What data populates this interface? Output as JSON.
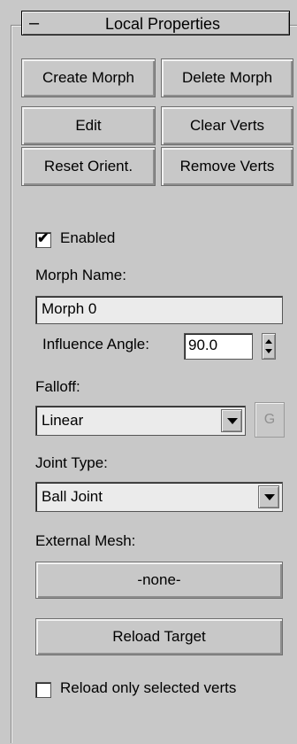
{
  "rollout": {
    "collapse_symbol": "–",
    "title": "Local Properties"
  },
  "buttons": {
    "create_morph": "Create Morph",
    "delete_morph": "Delete Morph",
    "edit": "Edit",
    "clear_verts": "Clear Verts",
    "reset_orient": "Reset Orient.",
    "remove_verts": "Remove Verts"
  },
  "enabled": {
    "label": "Enabled",
    "checked": true,
    "check_glyph": "✔"
  },
  "morph_name": {
    "label": "Morph Name:",
    "value": "Morph 0"
  },
  "influence_angle": {
    "label": "Influence Angle:",
    "value": "90.0"
  },
  "falloff": {
    "label": "Falloff:",
    "value": "Linear",
    "g_button": "G"
  },
  "joint_type": {
    "label": "Joint Type:",
    "value": "Ball Joint"
  },
  "external_mesh": {
    "label": "External Mesh:",
    "button": "-none-"
  },
  "reload_target": {
    "button": "Reload Target"
  },
  "reload_selected": {
    "label": "Reload only selected verts",
    "checked": false
  }
}
